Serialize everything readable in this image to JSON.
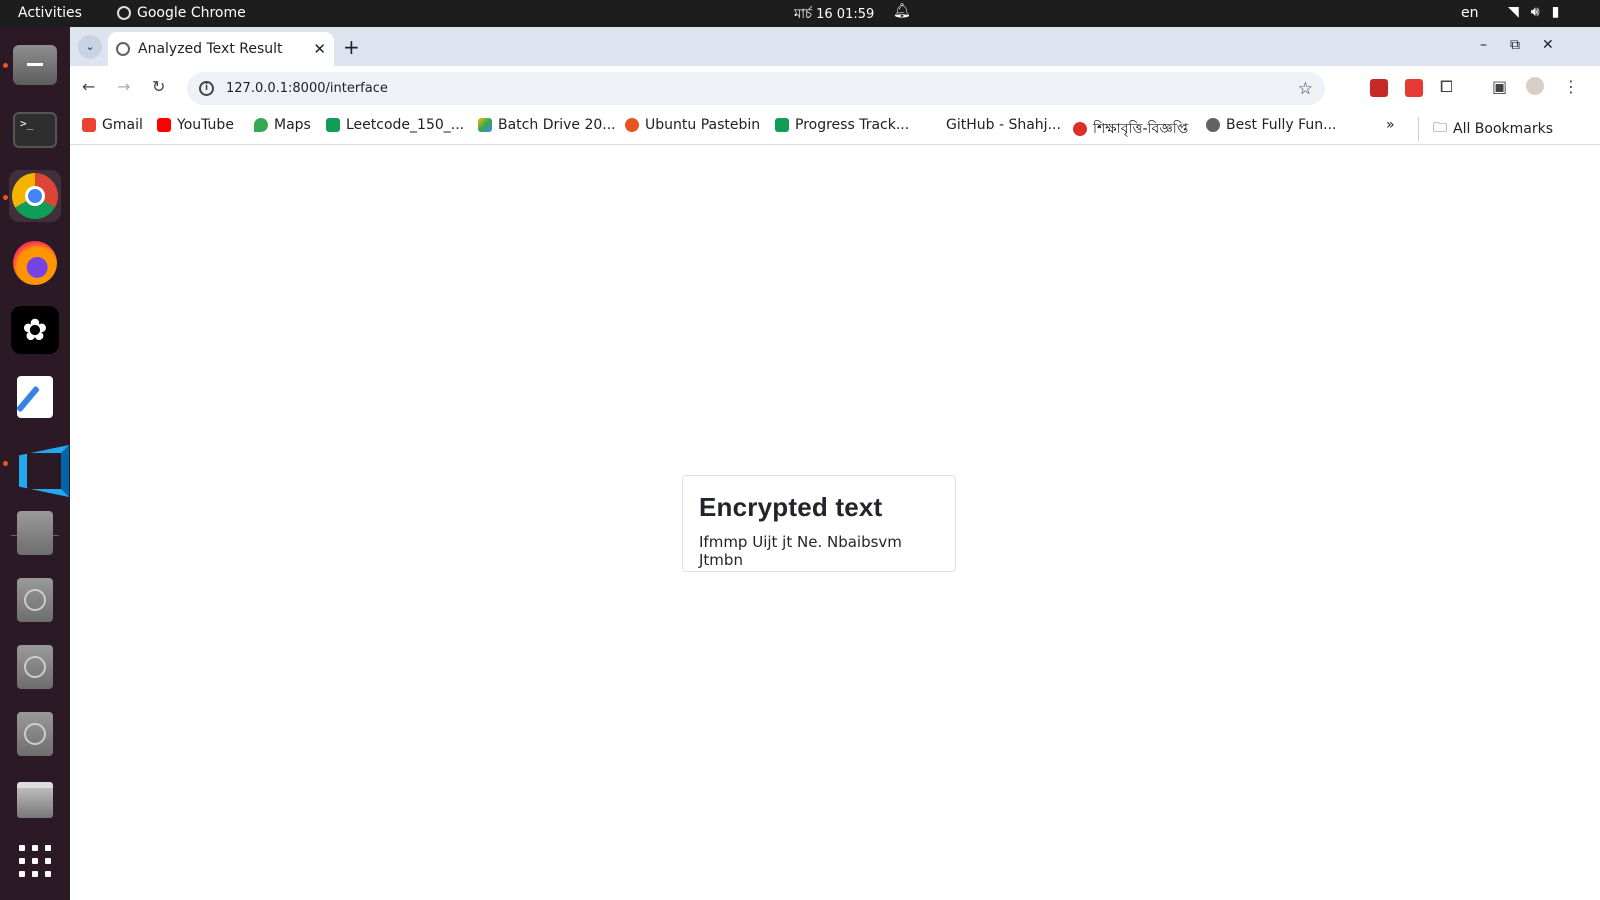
{
  "topbar": {
    "activities": "Activities",
    "app_name": "Google Chrome",
    "clock": "মার্চ 16  01:59",
    "language": "en"
  },
  "dock": {
    "items": [
      "files-icon",
      "terminal-icon",
      "chrome-icon",
      "firefox-icon",
      "chatgpt-icon",
      "text-editor-icon",
      "vscode-icon",
      "disk-icon",
      "disk-icon",
      "disk-icon",
      "disk-icon",
      "trash-icon",
      "app-grid-icon"
    ]
  },
  "browser": {
    "tab_title": "Analyzed Text Result",
    "url": "127.0.0.1:8000/interface",
    "bookmarks": [
      {
        "label": "Gmail",
        "color": "#ea4335"
      },
      {
        "label": "YouTube",
        "color": "#ff0000"
      },
      {
        "label": "Maps",
        "color": "#34a853"
      },
      {
        "label": "Leetcode_150_...",
        "color": "#0f9d58"
      },
      {
        "label": "Batch Drive 20...",
        "color": "#fbbc04"
      },
      {
        "label": "Ubuntu Pastebin",
        "color": "#e95420"
      },
      {
        "label": "Progress Track...",
        "color": "#0f9d58"
      },
      {
        "label": "GitHub - Shahj...",
        "color": "#ffffff"
      },
      {
        "label": "শিক্ষাবৃত্তি-বিজ্ঞপ্তি",
        "color": "#d93025"
      },
      {
        "label": "Best Fully Fun...",
        "color": "#5f6368"
      }
    ],
    "all_bookmarks": "All Bookmarks"
  },
  "card": {
    "heading": "Encrypted text",
    "text": "Ifmmp Uijt jt Ne. Nbaibsvm Jtmbn"
  }
}
